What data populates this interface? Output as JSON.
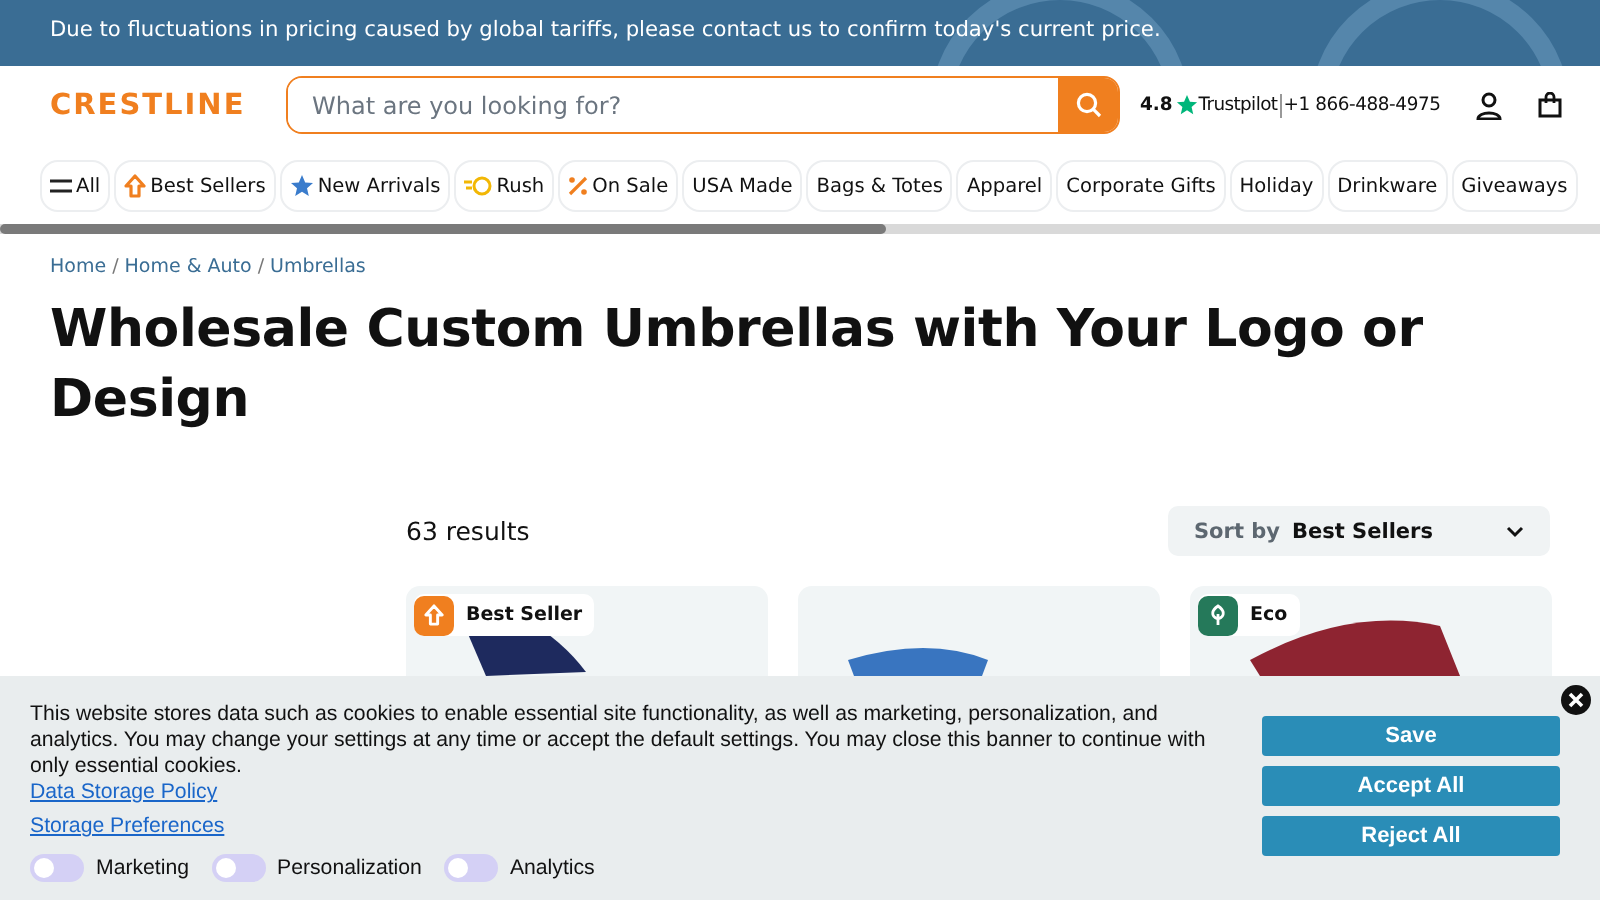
{
  "announcement": "Due to fluctuations in pricing caused by global tariffs, please contact us to confirm today's current price.",
  "header": {
    "logo": "CRESTLINE",
    "search": {
      "placeholder": "What are you looking for?"
    },
    "rating": "4.8",
    "review_site": "Trustpilot",
    "phone": "+1 866-488-4975"
  },
  "nav": [
    {
      "label": "All",
      "kind": "menu"
    },
    {
      "label": "Best Sellers",
      "kind": "up"
    },
    {
      "label": "New Arrivals",
      "kind": "star"
    },
    {
      "label": "Rush",
      "kind": "rush"
    },
    {
      "label": "On Sale",
      "kind": "percent"
    },
    {
      "label": "USA Made",
      "kind": "plain"
    },
    {
      "label": "Bags & Totes",
      "kind": "plain"
    },
    {
      "label": "Apparel",
      "kind": "plain"
    },
    {
      "label": "Corporate Gifts",
      "kind": "plain"
    },
    {
      "label": "Holiday",
      "kind": "plain"
    },
    {
      "label": "Drinkware",
      "kind": "plain"
    },
    {
      "label": "Giveaways",
      "kind": "plain"
    }
  ],
  "breadcrumb": [
    "Home",
    "Home & Auto",
    "Umbrellas"
  ],
  "breadcrumb_separator": "/",
  "title": "Wholesale Custom Umbrellas with Your Logo or Design",
  "results": "63 results",
  "sort": {
    "label": "Sort by",
    "value": "Best Sellers"
  },
  "products": [
    {
      "badged": true,
      "badge": {
        "label": "Best Seller",
        "kind": "up",
        "color": "#f07f1f"
      }
    },
    {
      "badged": false
    },
    {
      "badged": true,
      "badge": {
        "label": "Eco",
        "kind": "leaf",
        "color": "#25795a"
      }
    }
  ],
  "cookie_banner": {
    "text": "This website stores data such as cookies to enable essential site functionality, as well as marketing, personalization, and analytics. You may change your settings at any time or accept the default settings. You may close this banner to continue with only essential cookies.",
    "policy_link": "Data Storage Policy",
    "preferences_link": "Storage Preferences",
    "toggles": [
      {
        "label": "Marketing",
        "on": false
      },
      {
        "label": "Personalization",
        "on": false
      },
      {
        "label": "Analytics",
        "on": false
      }
    ],
    "buttons": [
      "Save",
      "Accept All",
      "Reject All"
    ]
  }
}
